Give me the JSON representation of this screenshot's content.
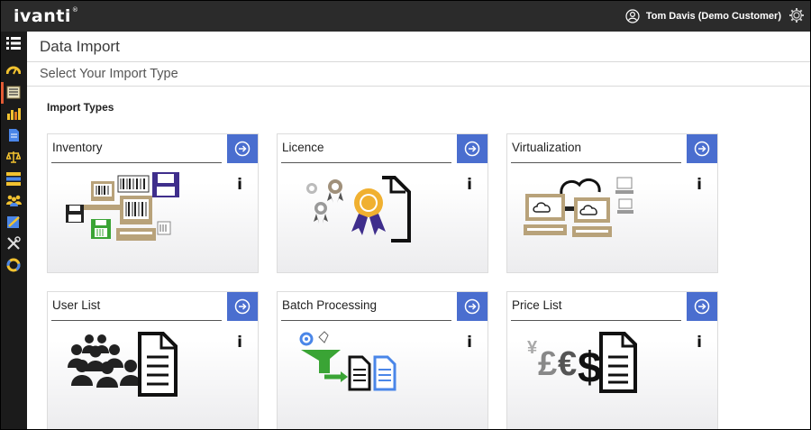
{
  "app": {
    "brand": "ivanti",
    "brand_mark": "®"
  },
  "header": {
    "user_name": "Tom Davis (Demo Customer)"
  },
  "page": {
    "title": "Data Import",
    "subtitle": "Select Your Import Type",
    "section_label": "Import Types"
  },
  "sidebar": {
    "active_color": "#e25b35",
    "items": [
      {
        "icon": "menu-list-icon"
      },
      {
        "icon": "dashboard-gauge-icon"
      },
      {
        "icon": "data-import-icon",
        "active": true
      },
      {
        "icon": "reports-chart-icon"
      },
      {
        "icon": "document-icon"
      },
      {
        "icon": "compliance-scales-icon"
      },
      {
        "icon": "inventory-list-icon"
      },
      {
        "icon": "users-group-icon"
      },
      {
        "icon": "licence-edit-icon"
      },
      {
        "icon": "tools-icon"
      },
      {
        "icon": "support-ring-icon"
      }
    ]
  },
  "cards": [
    {
      "title": "Inventory",
      "info": "i"
    },
    {
      "title": "Licence",
      "info": "i"
    },
    {
      "title": "Virtualization",
      "info": "i"
    },
    {
      "title": "User List",
      "info": "i"
    },
    {
      "title": "Batch Processing",
      "info": "i"
    },
    {
      "title": "Price List",
      "info": "i",
      "currency_symbols": "¥£€$"
    }
  ],
  "colors": {
    "topbar": "#2b2b2b",
    "accent_button": "#4a6ecf",
    "tan": "#b8a27a",
    "green": "#3aa435",
    "purple": "#3f2e8c",
    "gold": "#f0b030"
  }
}
